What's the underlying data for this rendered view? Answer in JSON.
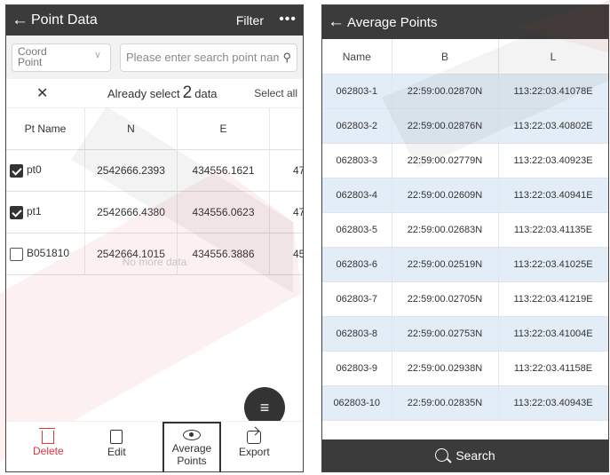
{
  "left": {
    "header": {
      "title": "Point Data",
      "filter": "Filter",
      "more": "•••"
    },
    "search": {
      "coord_type": "Coord Point",
      "placeholder": "Please enter search point nam"
    },
    "selection": {
      "prefix": "Already select",
      "count": "2",
      "suffix": "data",
      "select_all": "Select all"
    },
    "columns": [
      "Pt Name",
      "N",
      "E"
    ],
    "rows": [
      {
        "name": "pt0",
        "checked": true,
        "n": "2542666.2393",
        "e": "434556.1621",
        "extra": "47"
      },
      {
        "name": "pt1",
        "checked": true,
        "n": "2542666.4380",
        "e": "434556.0623",
        "extra": "47"
      },
      {
        "name": "B051810",
        "checked": false,
        "n": "2542664.1015",
        "e": "434556.3886",
        "extra": "45"
      }
    ],
    "no_more": "No more data",
    "toolbar": {
      "delete": "Delete",
      "edit": "Edit",
      "average": "Average Points",
      "export": "Export"
    }
  },
  "right": {
    "header": {
      "title": "Average Points"
    },
    "columns": [
      "Name",
      "B",
      "L"
    ],
    "rows": [
      [
        "062803-1",
        "22:59:00.02870N",
        "113:22:03.41078E"
      ],
      [
        "062803-2",
        "22:59:00.02876N",
        "113:22:03.40802E"
      ],
      [
        "062803-3",
        "22:59:00.02779N",
        "113:22:03.40923E"
      ],
      [
        "062803-4",
        "22:59:00.02609N",
        "113:22:03.40941E"
      ],
      [
        "062803-5",
        "22:59:00.02683N",
        "113:22:03.41135E"
      ],
      [
        "062803-6",
        "22:59:00.02519N",
        "113:22:03.41025E"
      ],
      [
        "062803-7",
        "22:59:00.02705N",
        "113:22:03.41219E"
      ],
      [
        "062803-8",
        "22:59:00.02753N",
        "113:22:03.41004E"
      ],
      [
        "062803-9",
        "22:59:00.02938N",
        "113:22:03.41158E"
      ],
      [
        "062803-10",
        "22:59:00.02835N",
        "113:22:03.40943E"
      ]
    ],
    "search_label": "Search"
  },
  "colors": {
    "header_bg": "#3b3b3b",
    "delete_red": "#d9363e",
    "row_alt": "#e3edf7"
  }
}
